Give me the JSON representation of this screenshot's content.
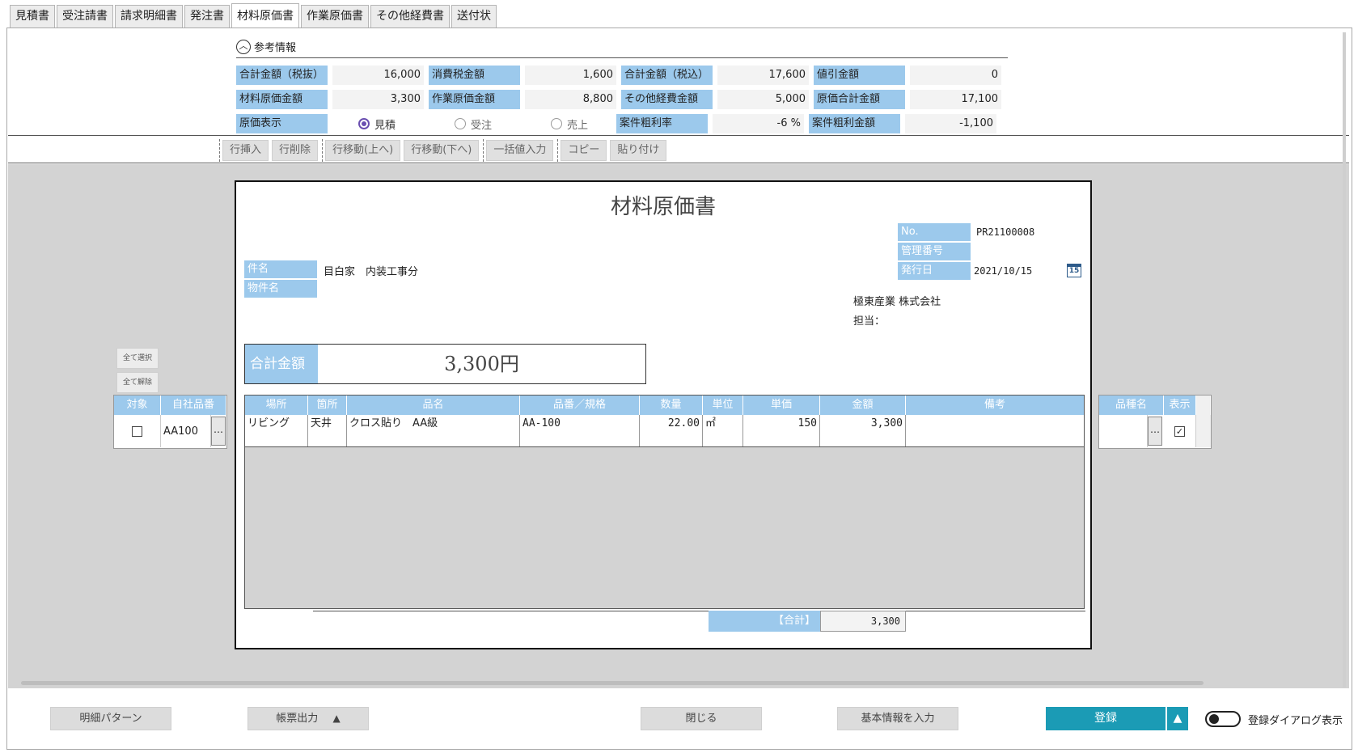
{
  "tabs": [
    "見積書",
    "受注請書",
    "請求明細書",
    "発注書",
    "材料原価書",
    "作業原価書",
    "その他経費書",
    "送付状"
  ],
  "reference": {
    "title": "参考情報",
    "rows": [
      [
        {
          "label": "合計金額（税抜）",
          "value": "16,000"
        },
        {
          "label": "消費税金額",
          "value": "1,600"
        },
        {
          "label": "合計金額（税込）",
          "value": "17,600"
        },
        {
          "label": "値引金額",
          "value": "0"
        }
      ],
      [
        {
          "label": "材料原価金額",
          "value": "3,300"
        },
        {
          "label": "作業原価金額",
          "value": "8,800"
        },
        {
          "label": "その他経費金額",
          "value": "5,000"
        },
        {
          "label": "原価合計金額",
          "value": "17,100"
        }
      ]
    ],
    "cost_display_label": "原価表示",
    "radios": [
      {
        "label": "見積",
        "checked": true
      },
      {
        "label": "受注",
        "checked": false
      },
      {
        "label": "売上",
        "checked": false
      }
    ],
    "margin_rate_label": "案件粗利率",
    "margin_rate_value": "-6 %",
    "margin_amount_label": "案件粗利金額",
    "margin_amount_value": "-1,100"
  },
  "toolbar": {
    "insert_row": "行挿入",
    "delete_row": "行削除",
    "move_up": "行移動(上へ)",
    "move_down": "行移動(下へ)",
    "bulk_input": "一括値入力",
    "copy": "コピー",
    "paste": "貼り付け"
  },
  "document": {
    "title": "材料原価書",
    "no_label": "No.",
    "no_value": "PR21100008",
    "mgmt_label": "管理番号",
    "mgmt_value": "",
    "issue_label": "発行日",
    "issue_value": "2021/10/15",
    "calendar_day": "15",
    "subject_label": "件名",
    "subject_value": "目白家　内装工事分",
    "property_label": "物件名",
    "property_value": "",
    "company": "極東産業 株式会社",
    "person_label": "担当：",
    "total_label": "合計金額",
    "total_value": "3,300円",
    "columns": [
      "場所",
      "箇所",
      "品名",
      "品番／規格",
      "数量",
      "単位",
      "単価",
      "金額",
      "備考"
    ],
    "rows": [
      {
        "place": "リビング",
        "spot": "天井",
        "name": "クロス貼り　AA級",
        "code": "AA-100",
        "qty": "22.00",
        "unit": "㎡",
        "price": "150",
        "amount": "3,300",
        "note": ""
      }
    ],
    "sum_label": "【合計】",
    "sum_value": "3,300"
  },
  "left_panel": {
    "select_all": "全て選択",
    "deselect_all": "全て解除",
    "columns": [
      "対象",
      "自社品番"
    ],
    "row": {
      "code": "AA100",
      "dots": "…"
    }
  },
  "right_panel": {
    "columns": [
      "品種名",
      "表示"
    ],
    "row": {
      "dots": "…",
      "check": "✓"
    }
  },
  "bottom": {
    "pattern": "明細パターン",
    "print": "帳票出力",
    "print_arrow": "▲",
    "close": "閉じる",
    "basic_info": "基本情報を入力",
    "register": "登録",
    "register_arrow": "▲",
    "dialog_toggle": "登録ダイアログ表示"
  },
  "colors": {
    "label_blue": "#9cc9ec",
    "accent_teal": "#1b9bb5"
  }
}
